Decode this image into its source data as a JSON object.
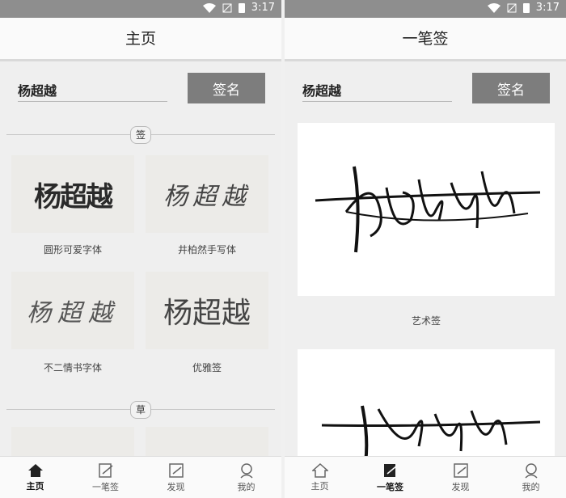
{
  "status": {
    "time": "3:17"
  },
  "left": {
    "title": "主页",
    "input_value": "杨超越",
    "sign_button": "签名",
    "section1_badge": "签",
    "section2_badge": "草",
    "cards": [
      {
        "signature": "杨超越",
        "caption": "圆形可爱字体"
      },
      {
        "signature": "杨超越",
        "caption": "井柏然手写体"
      },
      {
        "signature": "杨超越",
        "caption": "不二情书字体"
      },
      {
        "signature": "杨超越",
        "caption": "优雅签"
      }
    ]
  },
  "right": {
    "title": "一笔签",
    "input_value": "杨超越",
    "sign_button": "签名",
    "art_caption": "艺术签"
  },
  "tabs": {
    "left": [
      {
        "label": "主页",
        "icon": "home-icon"
      },
      {
        "label": "一笔签",
        "icon": "pen-icon"
      },
      {
        "label": "发现",
        "icon": "discover-icon"
      },
      {
        "label": "我的",
        "icon": "profile-icon"
      }
    ],
    "right": [
      {
        "label": "主页",
        "icon": "home-icon"
      },
      {
        "label": "一笔签",
        "icon": "pen-icon"
      },
      {
        "label": "发现",
        "icon": "discover-icon"
      },
      {
        "label": "我的",
        "icon": "profile-icon"
      }
    ]
  }
}
